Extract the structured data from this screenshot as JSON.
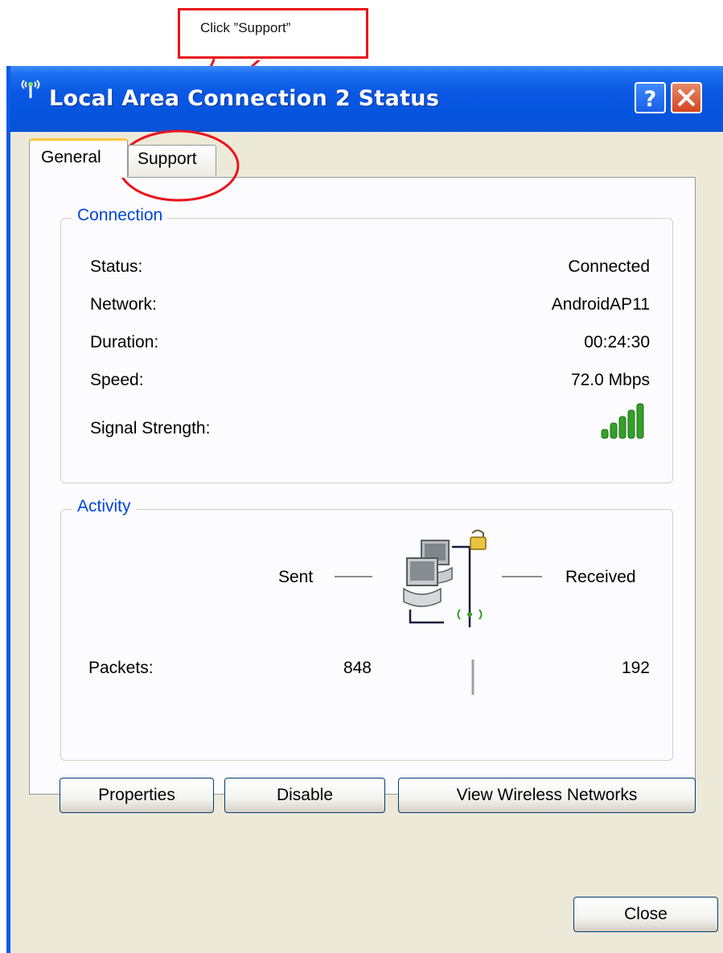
{
  "annotation": {
    "callout_text": "Click ”Support”",
    "highlight_color": "#e8141b"
  },
  "window": {
    "title": "Local Area Connection 2 Status",
    "help_glyph": "?",
    "accent": "#0a54e6"
  },
  "tabs": [
    {
      "label": "General",
      "selected": true
    },
    {
      "label": "Support",
      "selected": false
    }
  ],
  "connection": {
    "legend": "Connection",
    "rows": [
      {
        "label": "Status:",
        "value": "Connected"
      },
      {
        "label": "Network:",
        "value": "AndroidAP11"
      },
      {
        "label": "Duration:",
        "value": "00:24:30"
      },
      {
        "label": "Speed:",
        "value": "72.0 Mbps"
      }
    ],
    "signal_label": "Signal Strength:",
    "signal_bars": 5,
    "signal_color": "#35a02a"
  },
  "activity": {
    "legend": "Activity",
    "sent_label": "Sent",
    "received_label": "Received",
    "packets_label": "Packets:",
    "packets_sent": "848",
    "packets_received": "192"
  },
  "buttons": {
    "properties": "Properties",
    "disable": "Disable",
    "view_wireless": "View Wireless Networks",
    "close": "Close"
  },
  "icons": [
    "wireless-connection-icon",
    "help-icon",
    "close-icon",
    "signal-strength-icon",
    "network-computers-icon",
    "lock-icon"
  ]
}
